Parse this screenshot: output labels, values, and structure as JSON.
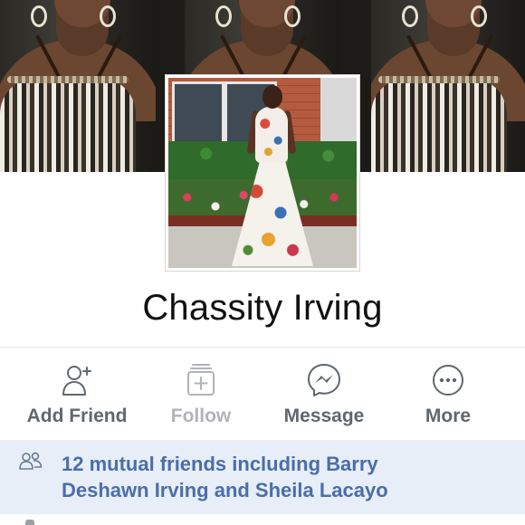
{
  "profile": {
    "name": "Chassity Irving"
  },
  "actions": [
    {
      "label": "Add Friend",
      "icon": "add-friend-icon",
      "enabled": true
    },
    {
      "label": "Follow",
      "icon": "follow-icon",
      "enabled": false
    },
    {
      "label": "Message",
      "icon": "messenger-icon",
      "enabled": true
    },
    {
      "label": "More",
      "icon": "more-icon",
      "enabled": true
    }
  ],
  "mutual_friends": {
    "icon": "friends-icon",
    "line1": "12 mutual friends including Barry",
    "line2": "Deshawn Irving and Sheila Lacayo"
  },
  "colors": {
    "action_text": "#606770",
    "action_disabled": "#b0b3b8",
    "mutual_bg": "#e7eef8",
    "mutual_text": "#4a6ea9"
  }
}
